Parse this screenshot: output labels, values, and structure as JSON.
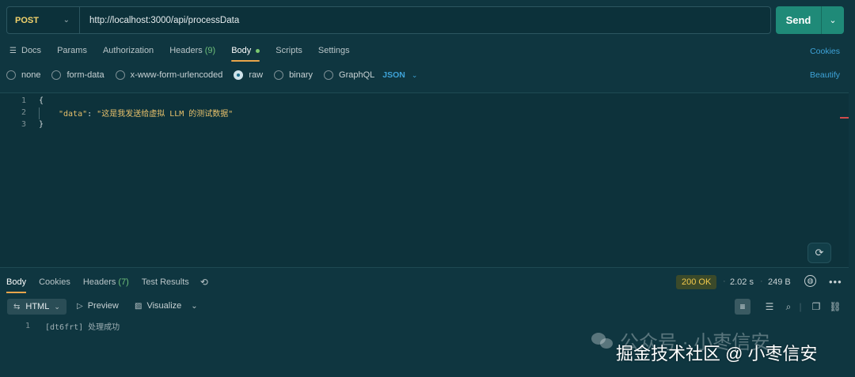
{
  "request": {
    "method": "POST",
    "url": "http://localhost:3000/api/processData",
    "send_label": "Send"
  },
  "request_tabs": {
    "docs": "Docs",
    "params": "Params",
    "authorization": "Authorization",
    "headers": "Headers",
    "headers_count": "(9)",
    "body": "Body",
    "scripts": "Scripts",
    "settings": "Settings"
  },
  "cookies_label": "Cookies",
  "body_types": {
    "none": "none",
    "form_data": "form-data",
    "urlencoded": "x-www-form-urlencoded",
    "raw": "raw",
    "binary": "binary",
    "graphql": "GraphQL",
    "selected": "raw",
    "format": "JSON"
  },
  "beautify_label": "Beautify",
  "editor": {
    "lines": [
      {
        "num": "1",
        "text": "{"
      },
      {
        "num": "2",
        "key": "\"data\"",
        "sep": ": ",
        "value": "\"这是我发送给虚拟 LLM 的测试数据\""
      },
      {
        "num": "3",
        "text": "}"
      }
    ]
  },
  "response_tabs": {
    "body": "Body",
    "cookies": "Cookies",
    "headers": "Headers",
    "headers_count": "(7)",
    "test_results": "Test Results"
  },
  "response_meta": {
    "status": "200 OK",
    "time": "2.02 s",
    "size": "249 B"
  },
  "response_toolbar": {
    "format": "HTML",
    "preview": "Preview",
    "visualize": "Visualize"
  },
  "response_body": {
    "line_num": "1",
    "text": "[dt6frt] 处理成功"
  },
  "watermark": {
    "line1": "公众号 · 小枣信安",
    "line2": "掘金技术社区 @ 小枣信安"
  },
  "colors": {
    "background": "#0f3640",
    "send_button": "#1f8a78",
    "method": "#f3d36c",
    "link": "#3ea3d8",
    "status_ok": "#f2c94c",
    "active_tab_underline": "#e8a54b"
  }
}
